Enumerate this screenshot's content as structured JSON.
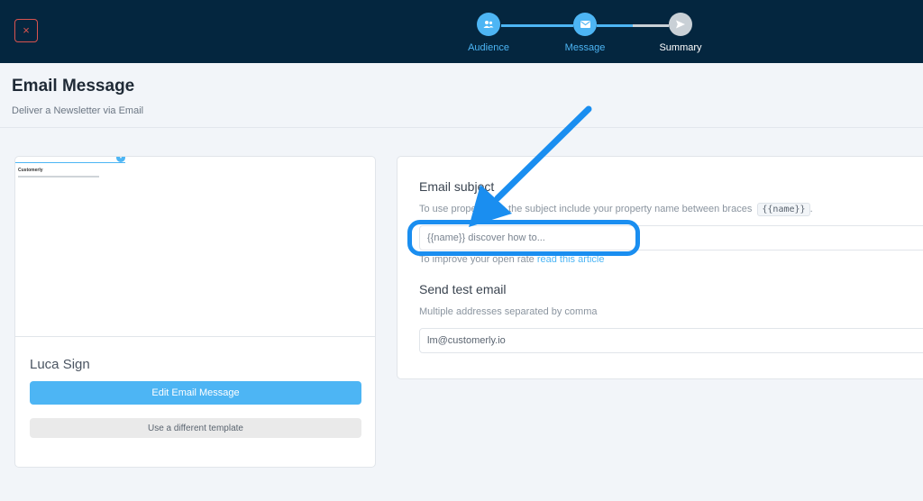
{
  "topbar": {
    "close_symbol": "×",
    "steps": [
      {
        "label": "Audience",
        "icon": "users-icon",
        "state": "done"
      },
      {
        "label": "Message",
        "icon": "envelope-icon",
        "state": "active"
      },
      {
        "label": "Summary",
        "icon": "send-icon",
        "state": "pending"
      }
    ]
  },
  "header": {
    "title": "Email Message",
    "subtitle": "Deliver a Newsletter via Email"
  },
  "template": {
    "name": "Luca Sign",
    "edit_label": "Edit Email Message",
    "different_label": "Use a different template",
    "preview_brand": "Customerly"
  },
  "form": {
    "subject_title": "Email subject",
    "subject_hint": "To use properties in the subject include your property name between braces",
    "subject_code": "{{name}}",
    "subject_hint_end": ".",
    "subject_placeholder": "{{name}} discover how to...",
    "improve_text": "To improve your open rate",
    "improve_link": "read this article",
    "test_title": "Send test email",
    "test_hint": "Multiple addresses separated by comma",
    "test_value": "lm@customerly.io"
  },
  "colors": {
    "topbar_bg": "#04263f",
    "accent": "#4db5f4",
    "callout": "#1a8ef0",
    "close_red": "#d9534f"
  }
}
